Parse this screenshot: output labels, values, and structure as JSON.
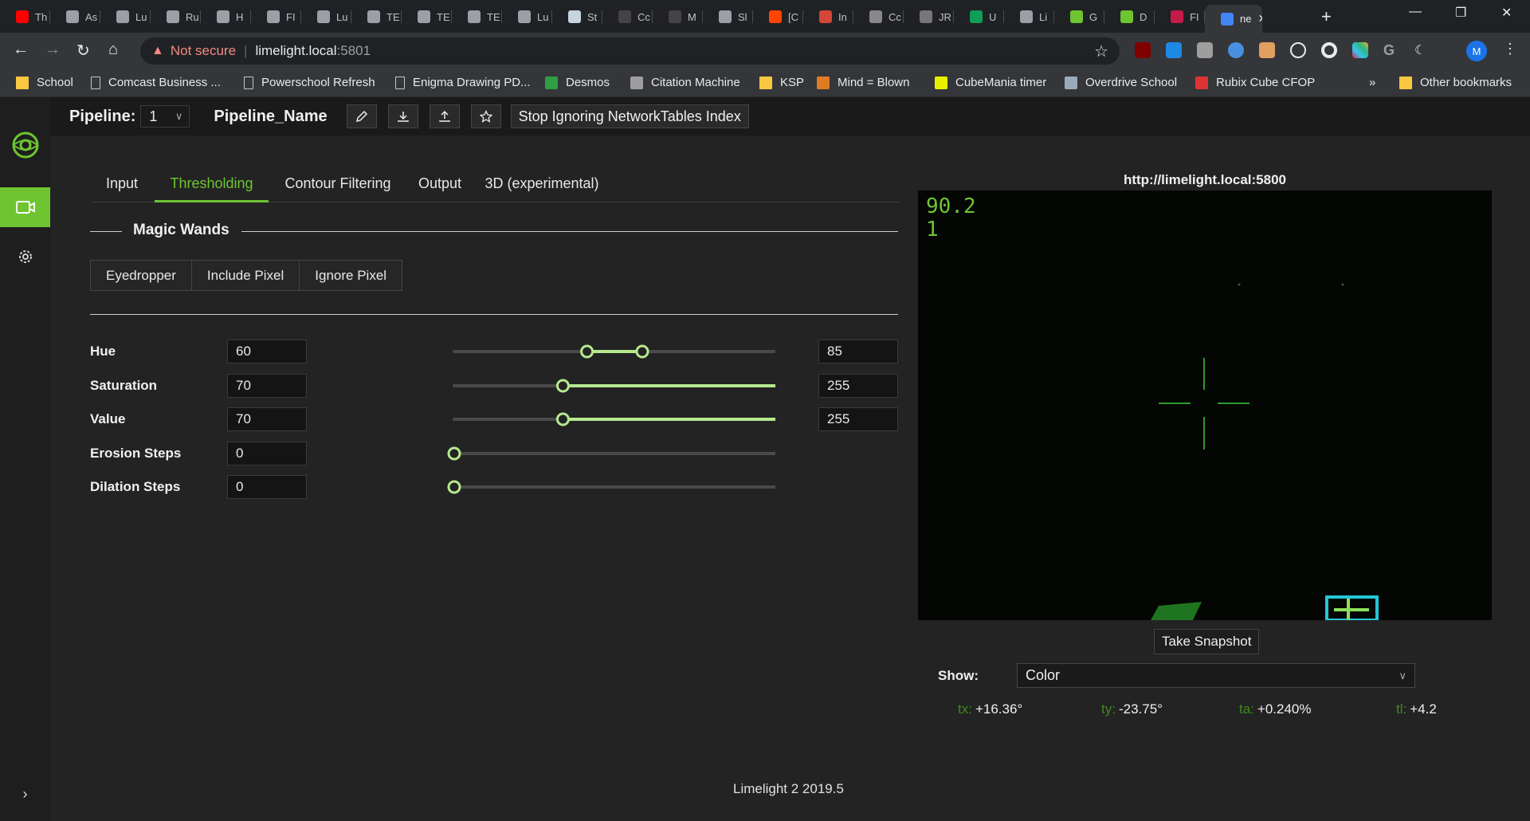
{
  "browser": {
    "tabs": [
      {
        "title": "Th",
        "color": "#ff0000"
      },
      {
        "title": "As",
        "color": "#9aa0a6"
      },
      {
        "title": "Lu",
        "color": "#9aa0a6"
      },
      {
        "title": "Ru",
        "color": "#9aa0a6"
      },
      {
        "title": "H",
        "color": "#9aa0a6"
      },
      {
        "title": "FI",
        "color": "#9aa0a6"
      },
      {
        "title": "Lu",
        "color": "#9aa0a6"
      },
      {
        "title": "TE",
        "color": "#9aa0a6"
      },
      {
        "title": "TE",
        "color": "#9aa0a6"
      },
      {
        "title": "TE",
        "color": "#9aa0a6"
      },
      {
        "title": "Lu",
        "color": "#9aa0a6"
      },
      {
        "title": "St",
        "color": "#c6d4df"
      },
      {
        "title": "Cc",
        "color": "#444444"
      },
      {
        "title": "M",
        "color": "#444444"
      },
      {
        "title": "Sl",
        "color": "#9aa0a6"
      },
      {
        "title": "[C",
        "color": "#ff4500"
      },
      {
        "title": "In",
        "color": "#d44638"
      },
      {
        "title": "Cc",
        "color": "#888888"
      },
      {
        "title": "JR",
        "color": "#777777"
      },
      {
        "title": "U",
        "color": "#0f9d58"
      },
      {
        "title": "Li",
        "color": "#9aa0a6"
      },
      {
        "title": "G",
        "color": "#6ec531"
      },
      {
        "title": "D",
        "color": "#6ec531"
      },
      {
        "title": "FI",
        "color": "#c51a4a"
      },
      {
        "title": "ne",
        "color": "#4285f4"
      }
    ],
    "active_tab_close": "✕",
    "new_tab": "+",
    "window_controls": {
      "minimize": "—",
      "restore": "❐",
      "close": "✕"
    },
    "address_bar": {
      "security_label": "Not secure",
      "url_host": "limelight.local",
      "url_port": ":5801"
    },
    "profile_initial": "M",
    "bookmarks": [
      {
        "label": "School",
        "icon": "folder-icon"
      },
      {
        "label": "Comcast Business ...",
        "icon": "page-icon"
      },
      {
        "label": "Powerschool Refresh",
        "icon": "page-icon"
      },
      {
        "label": "Enigma Drawing PD...",
        "icon": "page-icon"
      },
      {
        "label": "Desmos",
        "icon": "desmos-icon"
      },
      {
        "label": "Citation Machine",
        "icon": "citation-icon"
      },
      {
        "label": "KSP",
        "icon": "folder-icon"
      },
      {
        "label": "Mind = Blown",
        "icon": "gear-icon"
      },
      {
        "label": "CubeMania timer",
        "icon": "yellow-square-icon"
      },
      {
        "label": "Overdrive School",
        "icon": "overdrive-icon"
      },
      {
        "label": "Rubix Cube CFOP",
        "icon": "cube-icon"
      }
    ],
    "bookmarks_overflow": "»",
    "other_bookmarks": "Other bookmarks"
  },
  "app": {
    "pipeline_label": "Pipeline:",
    "pipeline_index": "1",
    "pipeline_name": "Pipeline_Name",
    "toolbar_icons": [
      "edit-icon",
      "download-icon",
      "upload-icon",
      "star-icon"
    ],
    "stop_button": "Stop Ignoring NetworkTables Index",
    "tabs": [
      "Input",
      "Thresholding",
      "Contour Filtering",
      "Output",
      "3D (experimental)"
    ],
    "active_tab": "Thresholding",
    "magic_wands": {
      "title": "Magic Wands",
      "buttons": [
        "Eyedropper",
        "Include Pixel",
        "Ignore Pixel"
      ]
    },
    "sliders": {
      "hue": {
        "label": "Hue",
        "min_value": "60",
        "max_value": "85",
        "range_min": 0,
        "range_max": 179
      },
      "saturation": {
        "label": "Saturation",
        "min_value": "70",
        "max_value": "255",
        "range_min": 0,
        "range_max": 255
      },
      "value": {
        "label": "Value",
        "min_value": "70",
        "max_value": "255",
        "range_min": 0,
        "range_max": 255
      },
      "erosion": {
        "label": "Erosion Steps",
        "value": "0",
        "range_min": 0,
        "range_max": 10
      },
      "dilation": {
        "label": "Dilation Steps",
        "value": "0",
        "range_min": 0,
        "range_max": 10
      }
    },
    "camera": {
      "stream_url": "http://limelight.local:5800",
      "overlay_line1": "90.2",
      "overlay_line2": "1"
    },
    "snapshot_button": "Take Snapshot",
    "show_label": "Show:",
    "show_value": "Color",
    "stats": {
      "tx_key": "tx:",
      "tx": "+16.36°",
      "ty_key": "ty:",
      "ty": "-23.75°",
      "ta_key": "ta:",
      "ta": "+0.240%",
      "tl_key": "tl:",
      "tl": "+4.2"
    },
    "version": "Limelight 2 2019.5",
    "colors": {
      "accent": "#6ec531",
      "background": "#232323"
    }
  }
}
